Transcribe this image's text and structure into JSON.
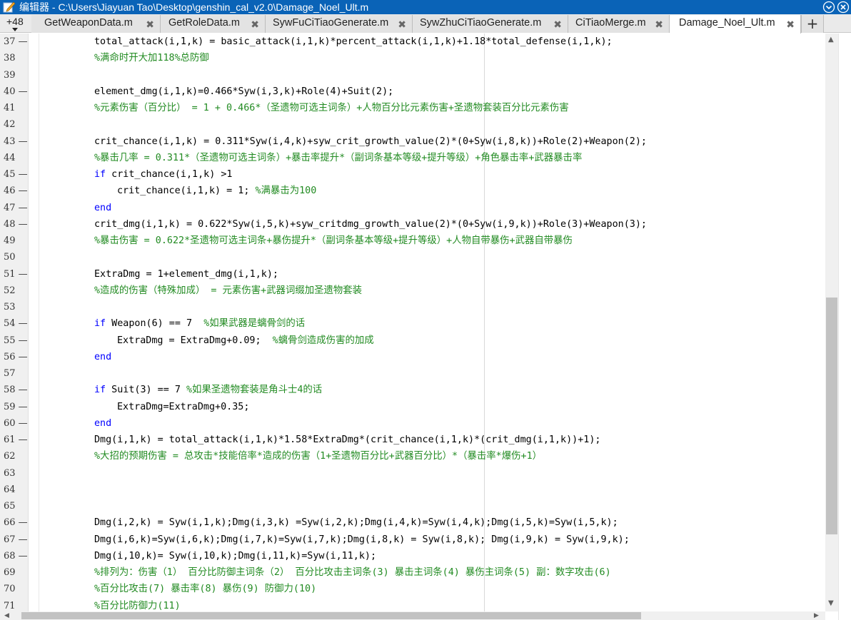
{
  "window": {
    "title": "编辑器 - C:\\Users\\Jiayuan Tao\\Desktop\\genshin_cal_v2.0\\Damage_Noel_Ult.m",
    "app_icon": "pencil-icon",
    "minimize_icon": "chevron-down-icon",
    "close_icon": "close-icon"
  },
  "tabs": {
    "hidden_count": "+48",
    "items": [
      {
        "label": "GetWeaponData.m",
        "active": false
      },
      {
        "label": "GetRoleData.m",
        "active": false
      },
      {
        "label": "SywFuCiTiaoGenerate.m",
        "active": false
      },
      {
        "label": "SywZhuCiTiaoGenerate.m",
        "active": false
      },
      {
        "label": "CiTiaoMerge.m",
        "active": false
      },
      {
        "label": "Damage_Noel_Ult.m",
        "active": true
      }
    ],
    "close_glyph": "✖",
    "add_glyph": "+"
  },
  "editor": {
    "lines": [
      {
        "num": "37 —",
        "text": "total_attack(i,1,k) = basic_attack(i,1,k)*percent_attack(i,1,k)+1.18*total_defense(i,1,k);"
      },
      {
        "num": "38",
        "text": "%满命时开大加118%总防御"
      },
      {
        "num": "39",
        "text": ""
      },
      {
        "num": "40 —",
        "text": "element_dmg(i,1,k)=0.466*Syw(i,3,k)+Role(4)+Suit(2);"
      },
      {
        "num": "41",
        "text": "%元素伤害（百分比） = 1 + 0.466*（圣遗物可选主词条）+人物百分比元素伤害+圣遗物套装百分比元素伤害"
      },
      {
        "num": "42",
        "text": ""
      },
      {
        "num": "43 —",
        "text": "crit_chance(i,1,k) = 0.311*Syw(i,4,k)+syw_crit_growth_value(2)*(0+Syw(i,8,k))+Role(2)+Weapon(2);"
      },
      {
        "num": "44",
        "text": "%暴击几率 = 0.311*（圣遗物可选主词条）+暴击率提升*（副词条基本等级+提升等级）+角色暴击率+武器暴击率"
      },
      {
        "num": "45 —",
        "kw": "if",
        "text": " crit_chance(i,1,k) >1"
      },
      {
        "num": "46 —",
        "text": "crit_chance(i,1,k) = 1; ",
        "comment": "%满暴击为100"
      },
      {
        "num": "47 —",
        "kw": "end",
        "text": ""
      },
      {
        "num": "48 —",
        "text": "crit_dmg(i,1,k) = 0.622*Syw(i,5,k)+syw_critdmg_growth_value(2)*(0+Syw(i,9,k))+Role(3)+Weapon(3);"
      },
      {
        "num": "49",
        "text": "%暴击伤害 = 0.622*圣遗物可选主词条+暴伤提升*（副词条基本等级+提升等级）+人物自带暴伤+武器自带暴伤"
      },
      {
        "num": "50",
        "text": ""
      },
      {
        "num": "51 —",
        "text": "ExtraDmg = 1+element_dmg(i,1,k);"
      },
      {
        "num": "52",
        "text": "%造成的伤害（特殊加成） = 元素伤害+武器词缀加圣遗物套装"
      },
      {
        "num": "53",
        "text": ""
      },
      {
        "num": "54 —",
        "kw": "if",
        "text": " Weapon(6) == 7  ",
        "comment": "%如果武器是螭骨剑的话"
      },
      {
        "num": "55 —",
        "text": "ExtraDmg = ExtraDmg+0.09;  ",
        "comment": "%螭骨剑造成伤害的加成"
      },
      {
        "num": "56 —",
        "kw": "end",
        "text": ""
      },
      {
        "num": "57",
        "text": ""
      },
      {
        "num": "58 —",
        "kw": "if",
        "text": " Suit(3) == 7 ",
        "comment": "%如果圣遗物套装是角斗士4的话"
      },
      {
        "num": "59 —",
        "text": "ExtraDmg=ExtraDmg+0.35;"
      },
      {
        "num": "60 —",
        "kw": "end",
        "text": ""
      },
      {
        "num": "61 —",
        "text": "Dmg(i,1,k) = total_attack(i,1,k)*1.58*ExtraDmg*(crit_chance(i,1,k)*(crit_dmg(i,1,k))+1);"
      },
      {
        "num": "62",
        "text": "%大招的预期伤害 = 总攻击*技能倍率*造成的伤害（1+圣遗物百分比+武器百分比）*（暴击率*爆伤+1）"
      },
      {
        "num": "63",
        "text": ""
      },
      {
        "num": "64",
        "text": ""
      },
      {
        "num": "65",
        "text": ""
      },
      {
        "num": "66 —",
        "text": "Dmg(i,2,k) = Syw(i,1,k);Dmg(i,3,k) =Syw(i,2,k);Dmg(i,4,k)=Syw(i,4,k);Dmg(i,5,k)=Syw(i,5,k);"
      },
      {
        "num": "67 —",
        "text": "Dmg(i,6,k)=Syw(i,6,k);Dmg(i,7,k)=Syw(i,7,k);Dmg(i,8,k) = Syw(i,8,k); Dmg(i,9,k) = Syw(i,9,k);"
      },
      {
        "num": "68 —",
        "text": "Dmg(i,10,k)= Syw(i,10,k);Dmg(i,11,k)=Syw(i,11,k);"
      },
      {
        "num": "69",
        "text": "%排列为：伤害（1） 百分比防御主词条（2） 百分比攻击主词条(3) 暴击主词条(4) 暴伤主词条(5) 副：数字攻击(6)"
      },
      {
        "num": "70",
        "text": "%百分比攻击(7) 暴击率(8) 暴伤(9) 防御力(10)"
      },
      {
        "num": "71",
        "text": "%百分比防御力(11)"
      }
    ]
  },
  "colors": {
    "titlebar": "#0a63b7",
    "keyword": "#0000ff",
    "comment": "#228b22",
    "code": "#000000"
  }
}
